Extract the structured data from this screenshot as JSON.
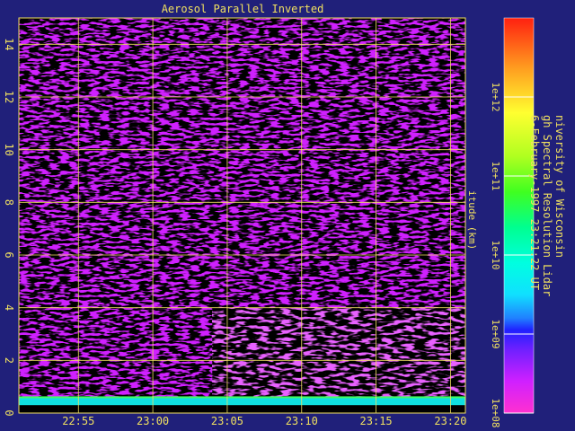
{
  "chart_data": {
    "type": "heatmap",
    "title": "Aerosol Parallel Inverted",
    "ylabel": "itude (km)",
    "xlabel": "",
    "x_ticks": [
      "22:55",
      "23:00",
      "23:05",
      "23:10",
      "23:15",
      "23:20"
    ],
    "y_ticks": [
      0,
      2,
      4,
      6,
      8,
      10,
      12,
      14
    ],
    "ylim": [
      0,
      15
    ],
    "xlim": [
      "22:51",
      "23:21"
    ],
    "grid": true,
    "colorbar": {
      "scale": "log",
      "range": [
        100000000.0,
        10000000000000.0
      ],
      "ticks": [
        "1e+08",
        "1e+09",
        "1e+10",
        "1e+11",
        "1e+12"
      ],
      "orientation": "vertical",
      "position": "right"
    },
    "regions": [
      {
        "x": [
          "22:51",
          "23:21"
        ],
        "y": [
          0.3,
          0.6
        ],
        "level": "1e+10"
      },
      {
        "x": [
          "22:51",
          "23:04"
        ],
        "y": [
          0.6,
          4.0
        ],
        "level": "1e+08"
      },
      {
        "x": [
          "23:04",
          "23:21"
        ],
        "y": [
          0.6,
          4.0
        ],
        "level": "below 1e+08"
      },
      {
        "x": [
          "22:51",
          "23:21"
        ],
        "y": [
          4.0,
          15.0
        ],
        "level": "1e+08"
      }
    ]
  },
  "credit_lines": [
    "niversity of Wisconsin",
    "gh Spectral Resolution Lidar",
    "6-February-1997 23:21:22 UT"
  ],
  "colors": {
    "background": "#20207a",
    "grid": "#f0e060",
    "text": "#f0e060",
    "signal": "#d020ff",
    "no_signal": "#000000",
    "surface_band": "#10e0e0"
  }
}
